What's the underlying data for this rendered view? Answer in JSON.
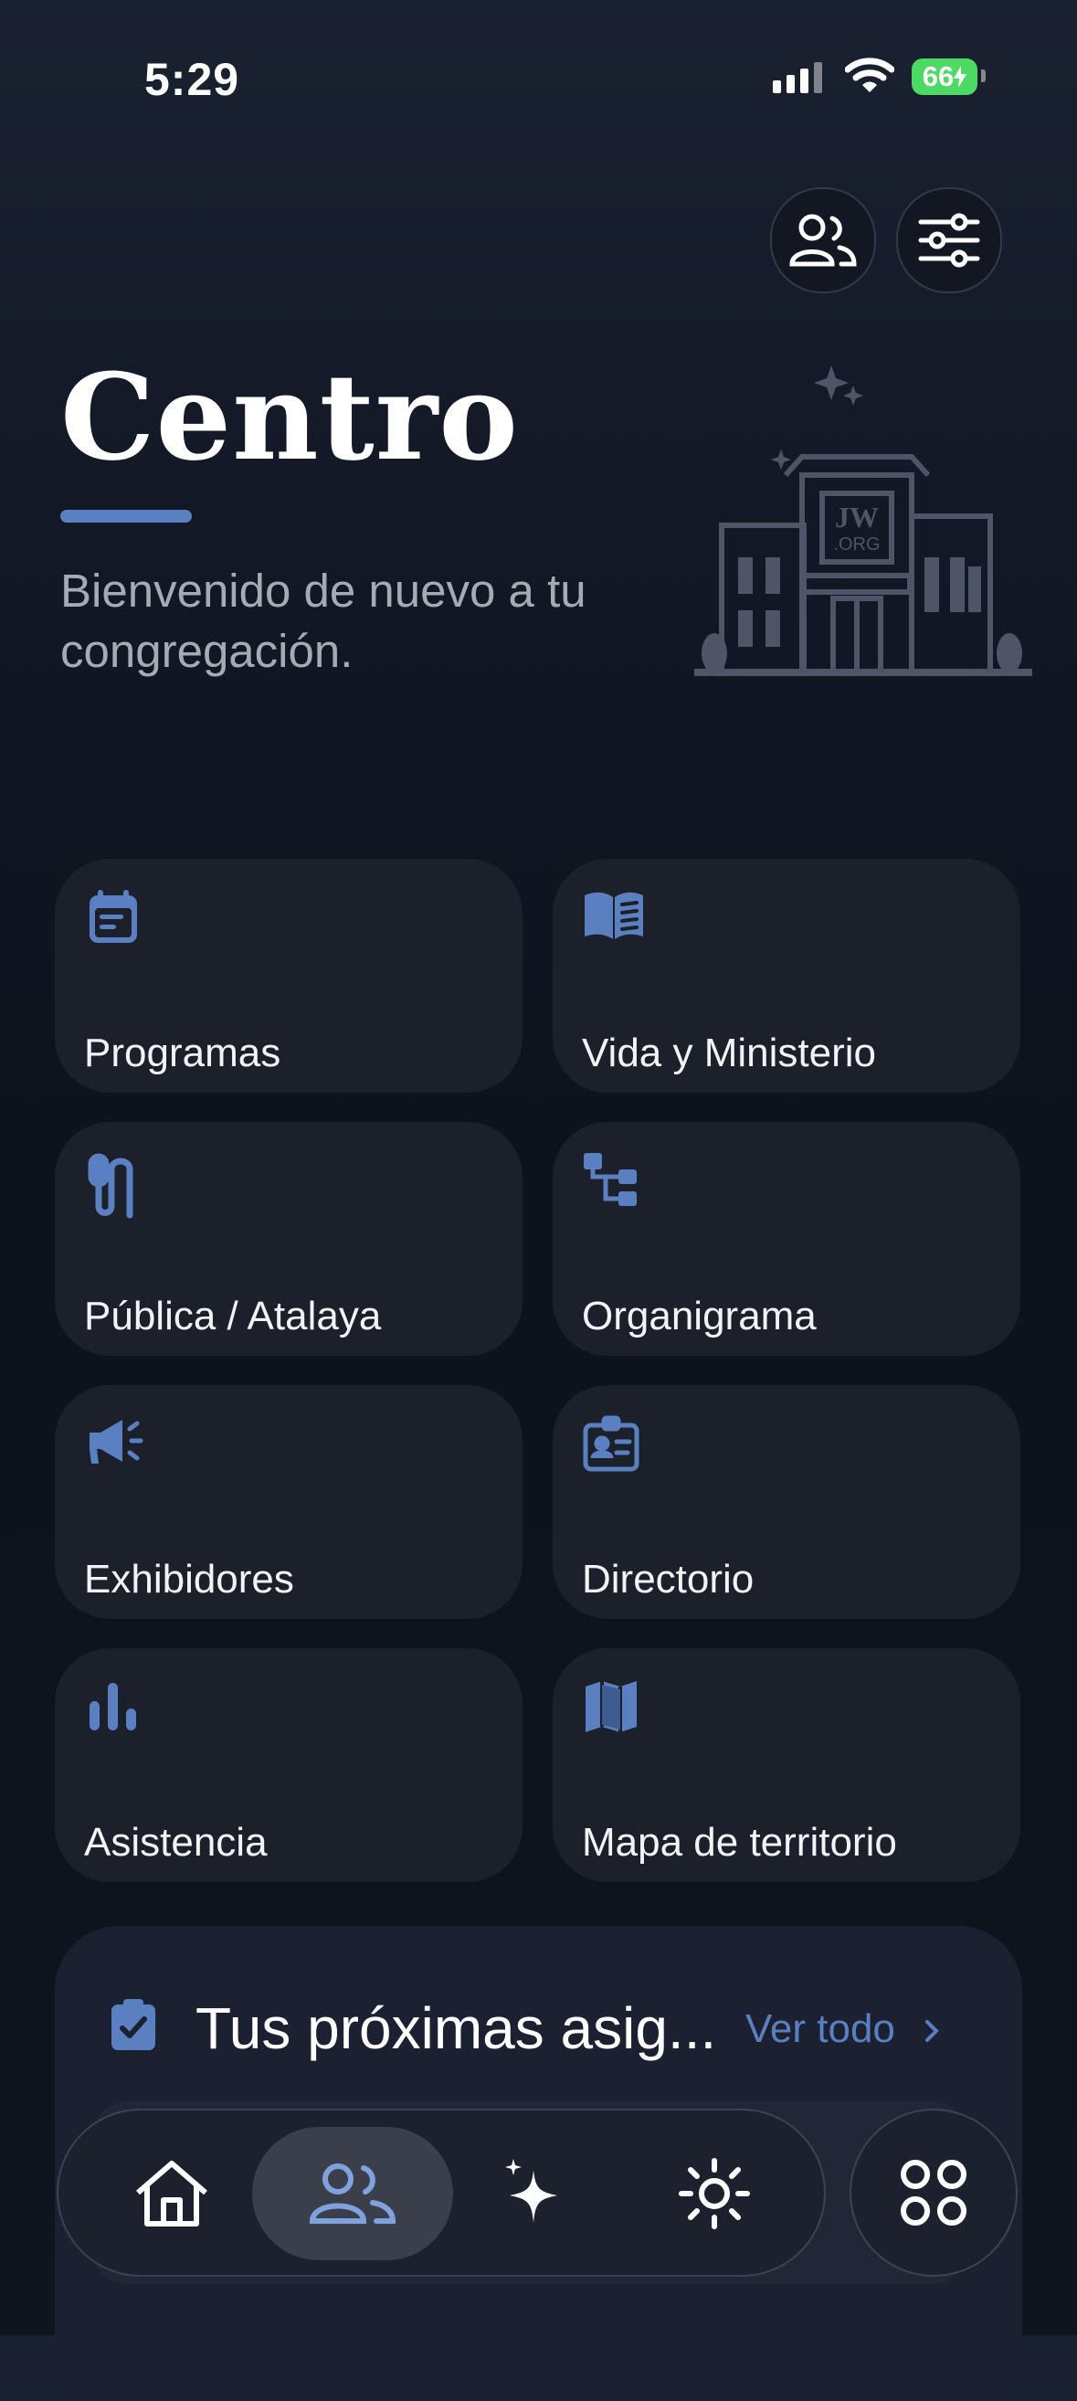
{
  "status_bar": {
    "time": "5:29",
    "battery": "66"
  },
  "header": {
    "title": "Centro",
    "subtitle": "Bienvenido de nuevo a tu congregación.",
    "illustration_sign": [
      "JW",
      ".ORG"
    ]
  },
  "top_actions": [
    {
      "icon": "people-icon"
    },
    {
      "icon": "sliders-icon"
    }
  ],
  "grid": [
    {
      "label": "Programas",
      "icon": "calendar-icon"
    },
    {
      "label": "Vida y Ministerio",
      "icon": "book-icon"
    },
    {
      "label": "Pública / Atalaya",
      "icon": "microphone-icon"
    },
    {
      "label": "Organigrama",
      "icon": "org-chart-icon"
    },
    {
      "label": "Exhibidores",
      "icon": "megaphone-icon"
    },
    {
      "label": "Directorio",
      "icon": "id-card-icon"
    },
    {
      "label": "Asistencia",
      "icon": "bar-chart-icon"
    },
    {
      "label": "Mapa de territorio",
      "icon": "map-icon"
    }
  ],
  "assignments": {
    "title": "Tus próximas asig...",
    "view_all": "Ver todo",
    "icon": "clipboard-check-icon"
  },
  "tab_bar": {
    "tabs": [
      {
        "icon": "home-icon"
      },
      {
        "icon": "people-icon",
        "active": true
      },
      {
        "icon": "sparkles-icon"
      },
      {
        "icon": "sun-icon"
      }
    ],
    "apps_icon": "grid-icon"
  },
  "colors": {
    "accent": "#5a80c2",
    "card": "#1b202a",
    "background": "#0d121c"
  }
}
